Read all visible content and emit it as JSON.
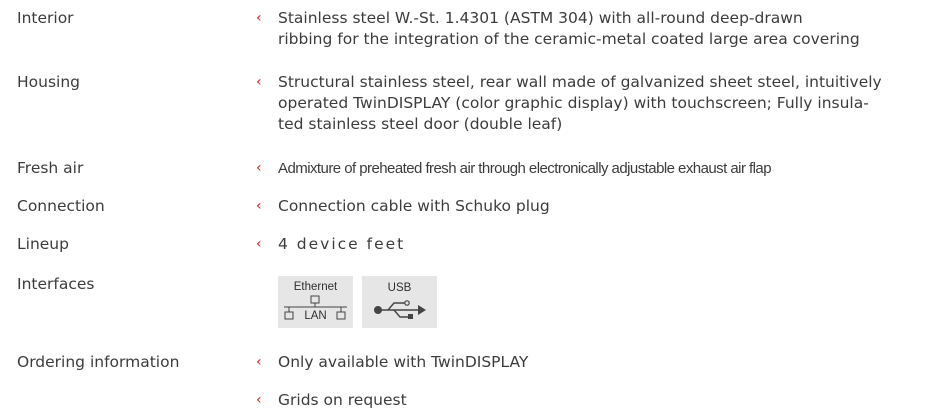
{
  "specs": [
    {
      "label": "Interior",
      "value": "Stainless steel W.-St. 1.4301 (ASTM 304) with all-round deep-drawn\nribbing for the integration of the ceramic-metal coated large area covering"
    },
    {
      "label": "Housing",
      "value": "Structural stainless steel, rear wall made of galvanized sheet steel, intuitively\noperated TwinDISPLAY (color graphic display) with touchscreen; Fully insula-\nted stainless steel door (double leaf)"
    },
    {
      "label": "Fresh air",
      "value": "Admixture of preheated fresh air through electronically adjustable exhaust air flap"
    },
    {
      "label": "Connection",
      "value": "Connection cable with Schuko plug"
    },
    {
      "label": "Lineup",
      "value": "4 device feet"
    },
    {
      "label": "Interfaces",
      "ethernet_top": "Ethernet",
      "ethernet_bottom": "LAN",
      "usb": "USB"
    },
    {
      "label": "Ordering information",
      "value": "Only available with TwinDISPLAY"
    },
    {
      "value": "Grids on request"
    }
  ],
  "bullet_glyph": "‹",
  "colors": {
    "bullet": "#d6241f",
    "text": "#3c3c3c",
    "badge_bg": "#e6e6e6"
  },
  "icons": [
    "ethernet-icon",
    "usb-icon"
  ]
}
